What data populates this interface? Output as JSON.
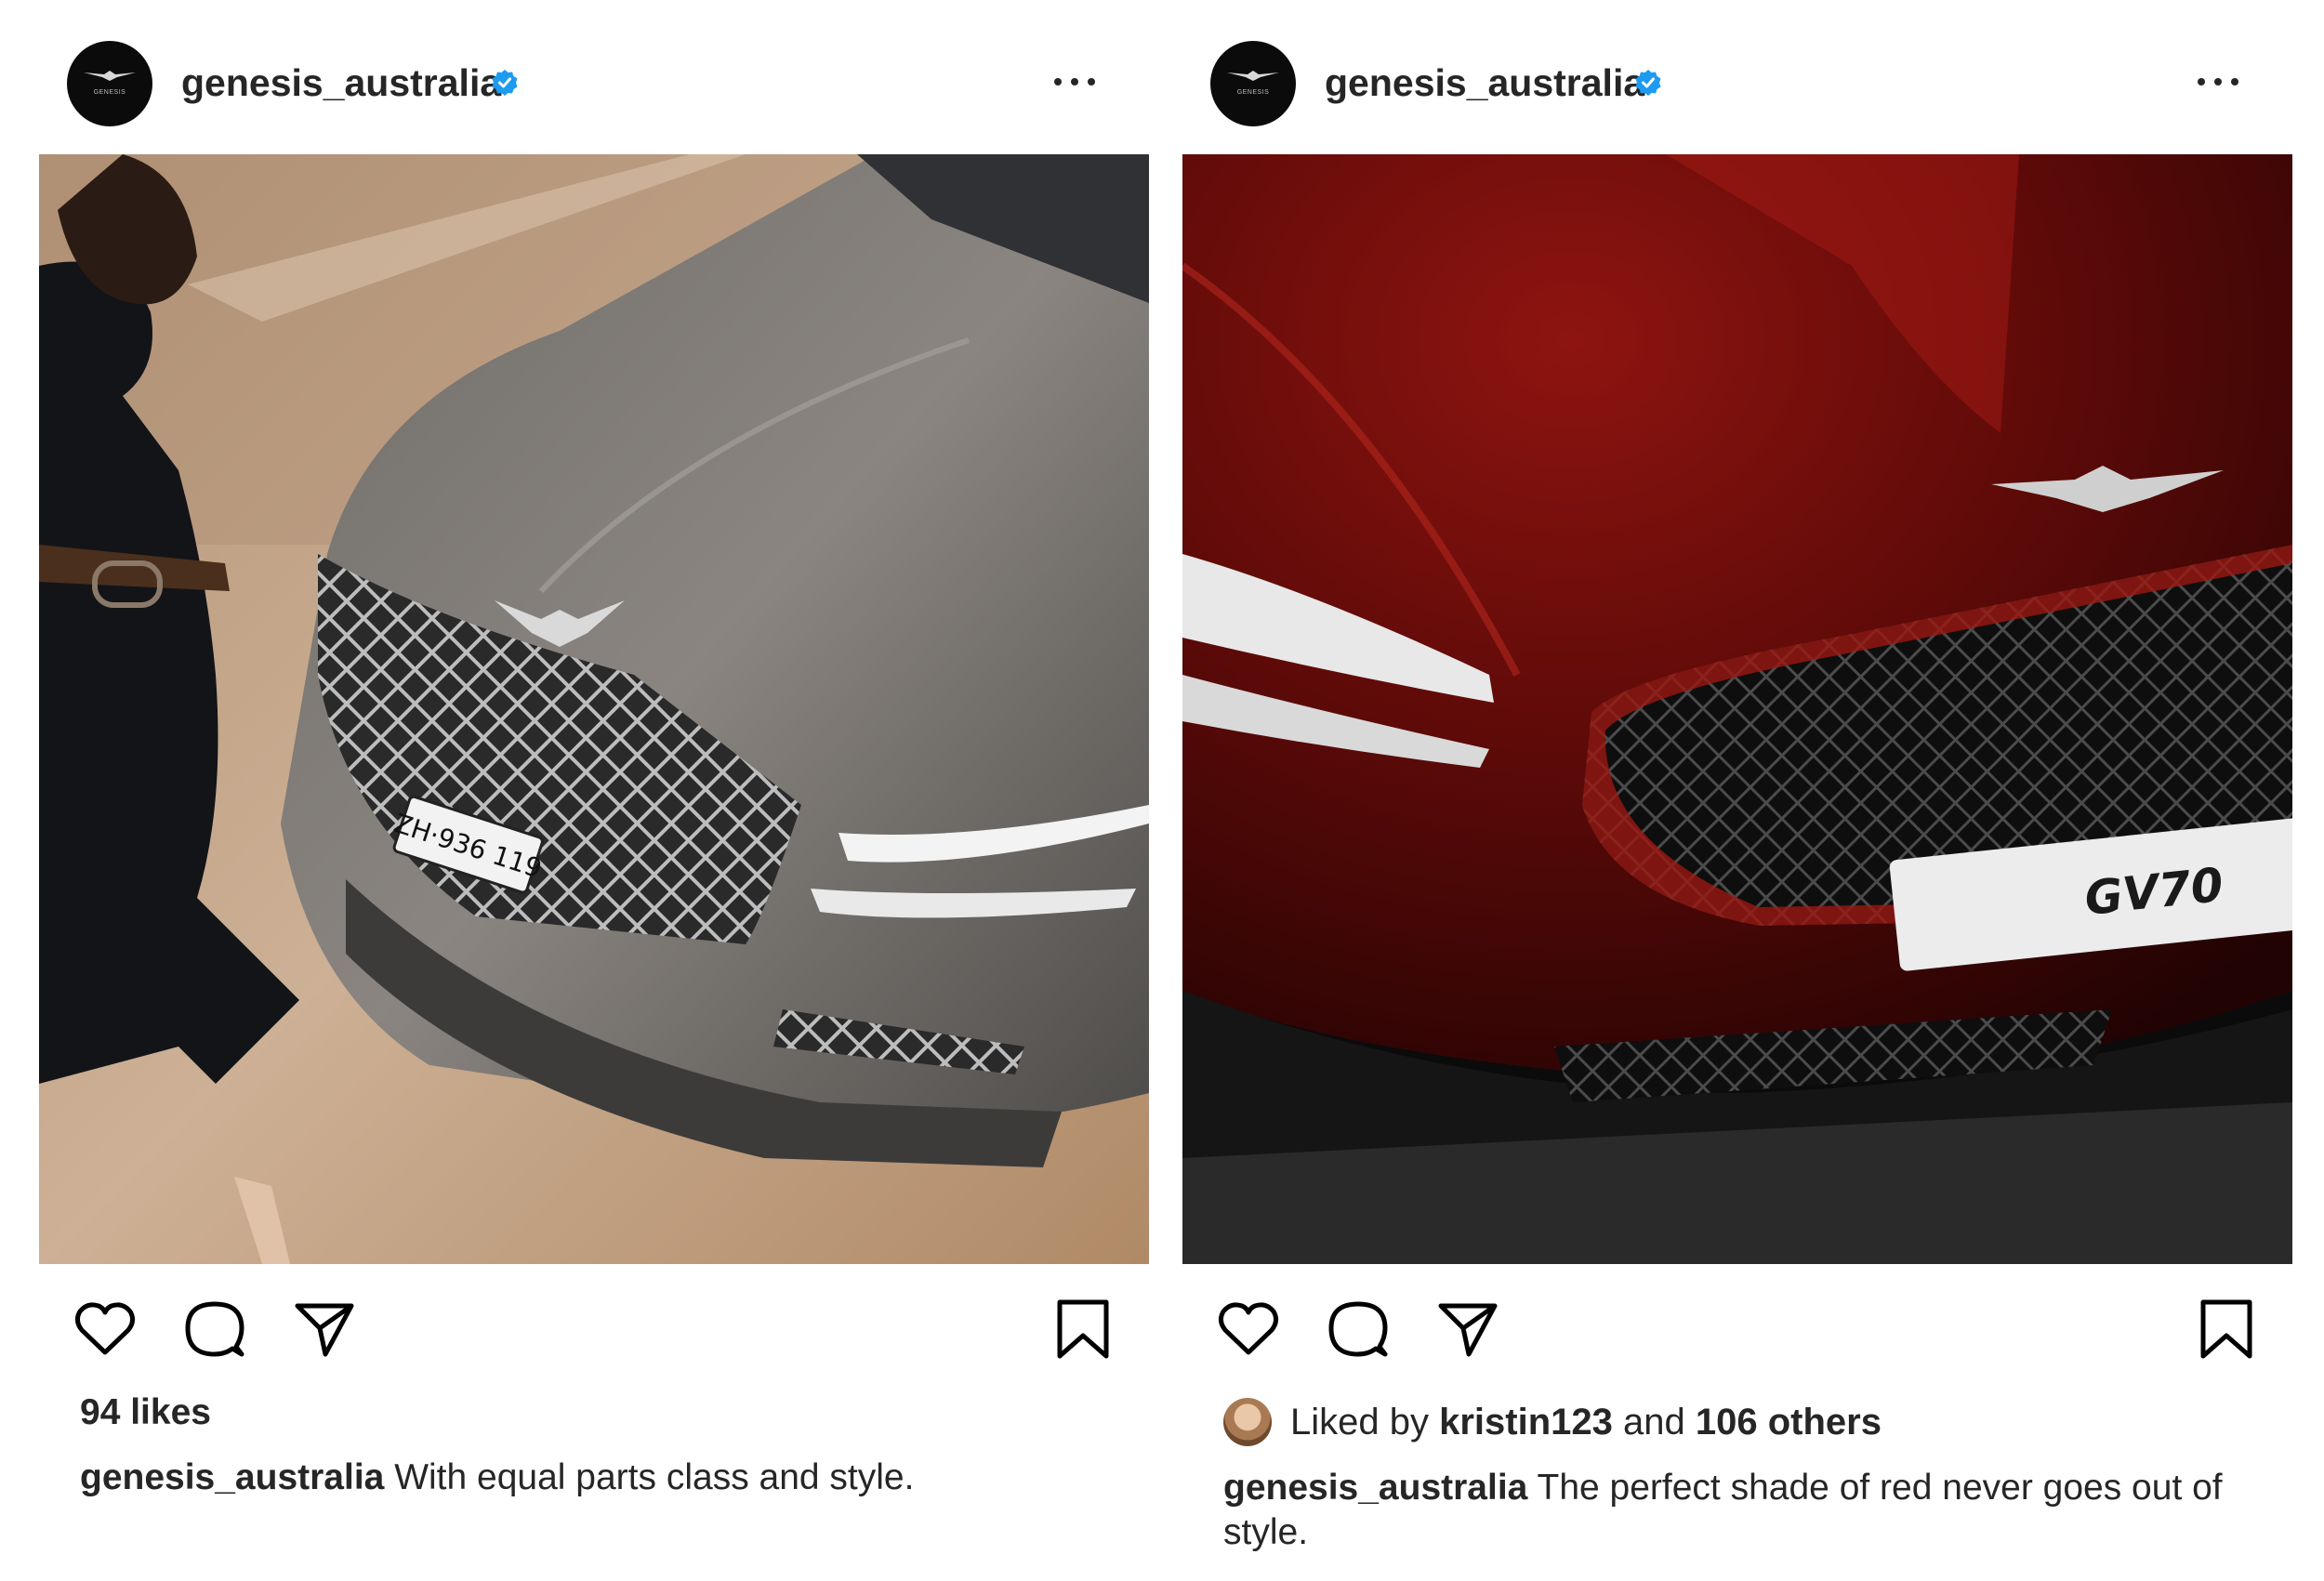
{
  "posts": [
    {
      "username": "genesis_australia",
      "avatar_text": "GENESIS",
      "verified_icon": "verified-badge-icon",
      "more_icon": "more-options-icon",
      "image_description_icon": "car-photo",
      "icons": {
        "like": "heart-icon",
        "comment": "comment-bubble-icon",
        "share": "paper-plane-icon",
        "save": "bookmark-icon"
      },
      "likes": "94 likes",
      "caption_user": "genesis_australia",
      "caption_text": "With equal parts class and style.",
      "plate_text": "ZH·936 119"
    },
    {
      "username": "genesis_australia",
      "avatar_text": "GENESIS",
      "verified_icon": "verified-badge-icon",
      "more_icon": "more-options-icon",
      "icons": {
        "like": "heart-icon",
        "comment": "comment-bubble-icon",
        "share": "paper-plane-icon",
        "save": "bookmark-icon"
      },
      "liked_prefix": "Liked by",
      "liked_user": "kristin123",
      "liked_and": "and",
      "liked_others": "106 others",
      "caption_user": "genesis_australia",
      "caption_text": "The perfect shade of red never goes out of style.",
      "plate_text": "GV70"
    }
  ],
  "colors": {
    "verified": "#1d9bf0",
    "text": "#262626",
    "red_car": "#7a0a0a",
    "grey_car": "#5a5855"
  }
}
